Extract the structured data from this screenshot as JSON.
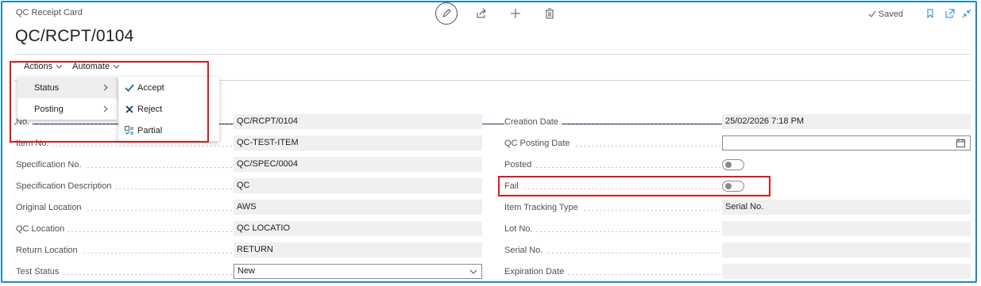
{
  "header": {
    "breadcrumb": "QC Receipt Card",
    "title": "QC/RCPT/0104",
    "saved_label": "Saved"
  },
  "toolbar": {
    "icons": [
      "edit-icon",
      "share-icon",
      "new-icon",
      "delete-icon",
      "bookmark-icon",
      "open-new-window-icon",
      "collapse-icon"
    ]
  },
  "action_bar": {
    "actions_label": "Actions",
    "automate_label": "Automate"
  },
  "actions_menu": {
    "items": [
      {
        "label": "Status"
      },
      {
        "label": "Posting"
      }
    ]
  },
  "status_submenu": {
    "items": [
      {
        "label": "Accept",
        "icon": "check-icon"
      },
      {
        "label": "Reject",
        "icon": "x-icon"
      },
      {
        "label": "Partial",
        "icon": "partial-icon"
      }
    ]
  },
  "fields_left": [
    {
      "label": "No.",
      "value": "QC/RCPT/0104"
    },
    {
      "label": "Item No.",
      "value": "QC-TEST-ITEM"
    },
    {
      "label": "Specification No.",
      "value": "QC/SPEC/0004"
    },
    {
      "label": "Specification Description",
      "value": "QC"
    },
    {
      "label": "Original Location",
      "value": "AWS"
    },
    {
      "label": "QC Location",
      "value": "QC LOCATIO"
    },
    {
      "label": "Return Location",
      "value": "RETURN"
    },
    {
      "label": "Test Status",
      "value": "New"
    }
  ],
  "fields_right": [
    {
      "label": "Creation Date",
      "value": "25/02/2026 7:18 PM"
    },
    {
      "label": "QC Posting Date",
      "value": ""
    },
    {
      "label": "Posted",
      "value": "off"
    },
    {
      "label": "Fail",
      "value": "off"
    },
    {
      "label": "Item Tracking Type",
      "value": "Serial No."
    },
    {
      "label": "Lot No.",
      "value": ""
    },
    {
      "label": "Serial No.",
      "value": ""
    },
    {
      "label": "Expiration Date",
      "value": ""
    }
  ],
  "colors": {
    "accent": "#1a86d6",
    "highlight": "#e3161b",
    "check": "#1f6f8b"
  }
}
